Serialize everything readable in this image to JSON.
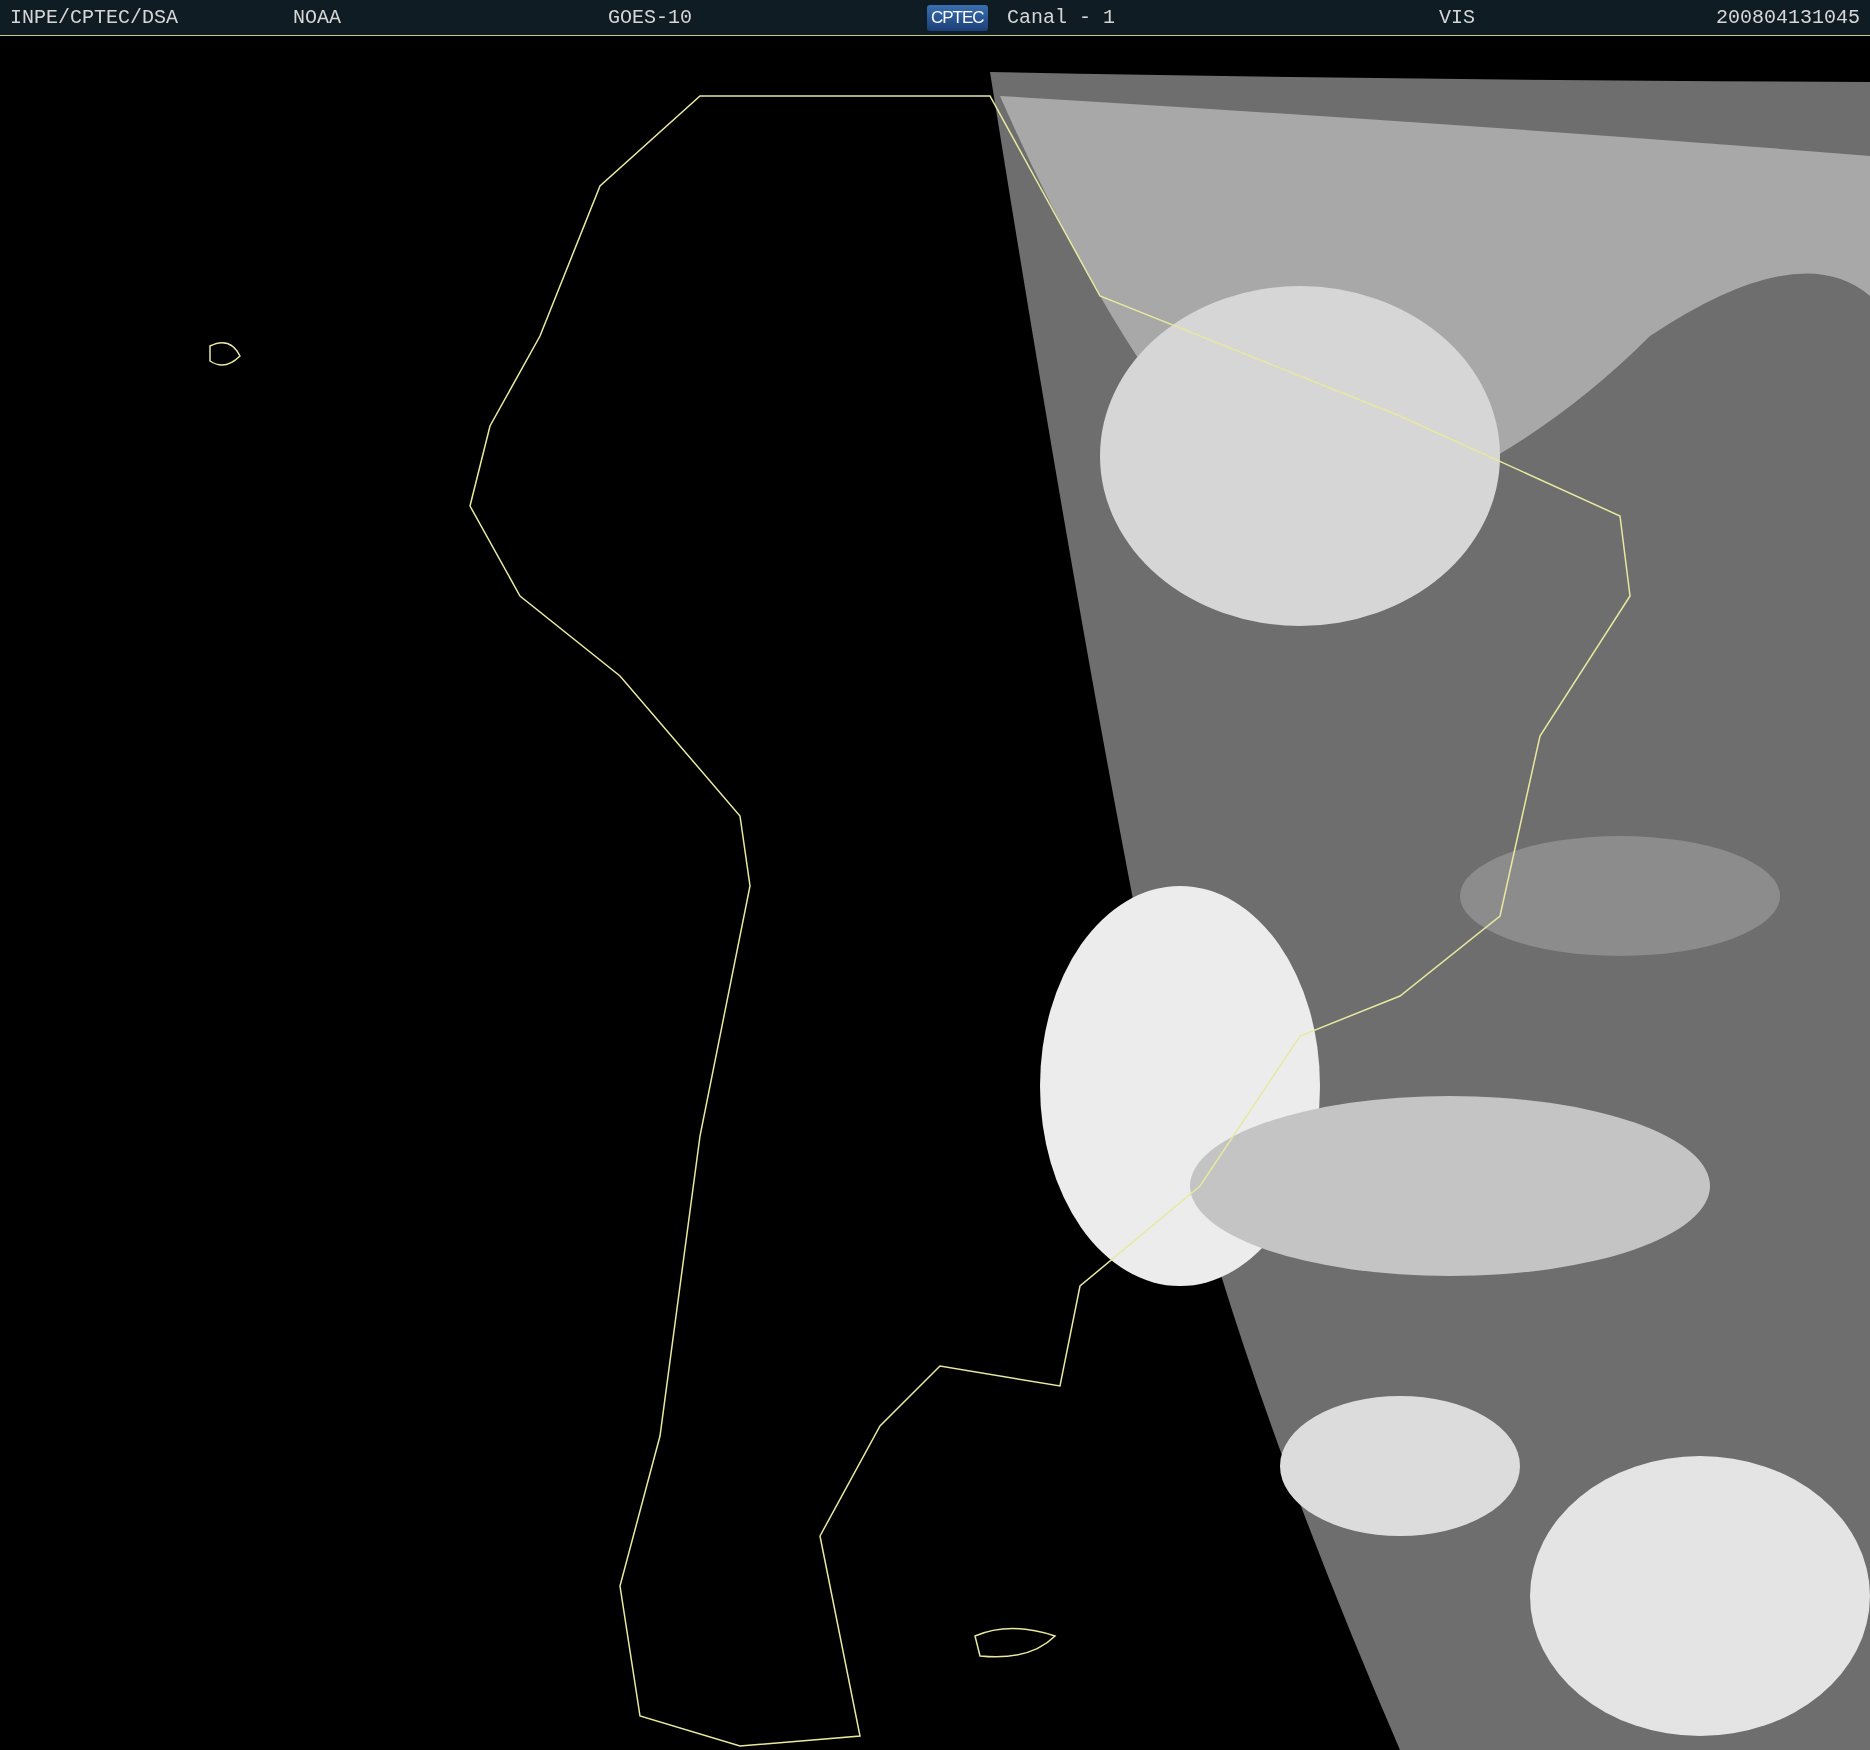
{
  "header": {
    "labels": [
      "INPE/CPTEC/DSA",
      "NOAA",
      "GOES-10"
    ],
    "logo": "CPTEC",
    "channel": "Canal - 1",
    "band": "VIS",
    "timestamp": "200804131045"
  }
}
